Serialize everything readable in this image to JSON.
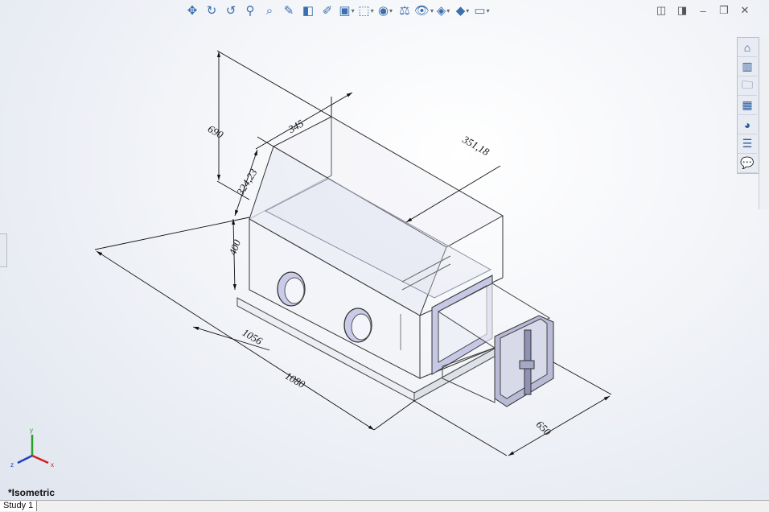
{
  "toolbar": {
    "items": [
      {
        "icon": "pan-icon",
        "glyph": "✥"
      },
      {
        "icon": "rotate-icon",
        "glyph": "↻"
      },
      {
        "icon": "redo-view-icon",
        "glyph": "↺"
      },
      {
        "icon": "zoom-to-fit-icon",
        "glyph": "⚲"
      },
      {
        "icon": "zoom-area-icon",
        "glyph": "⌕"
      },
      {
        "icon": "previous-view-icon",
        "glyph": "✎"
      },
      {
        "icon": "section-view-icon",
        "glyph": "◧"
      },
      {
        "icon": "dynamic-annotation-icon",
        "glyph": "✐"
      },
      {
        "icon": "view-orientation-icon",
        "glyph": "▣",
        "dropdown": true
      },
      {
        "icon": "display-style-icon",
        "glyph": "⬚",
        "dropdown": true
      },
      {
        "icon": "hide-show-items-icon",
        "glyph": "◉",
        "dropdown": true
      },
      {
        "icon": "edit-appearance-icon",
        "glyph": "⚖"
      },
      {
        "icon": "apply-scene-icon",
        "glyph": "👁",
        "dropdown": true
      },
      {
        "icon": "view-settings-icon",
        "glyph": "◈",
        "dropdown": true
      },
      {
        "icon": "render-tools-icon",
        "glyph": "◆",
        "dropdown": true
      },
      {
        "icon": "monitor-icon",
        "glyph": "▭",
        "dropdown": true
      }
    ]
  },
  "window_controls": [
    {
      "icon": "tile-left-icon",
      "glyph": "◫"
    },
    {
      "icon": "tile-right-icon",
      "glyph": "◨"
    },
    {
      "icon": "minimize-icon",
      "glyph": "–"
    },
    {
      "icon": "restore-icon",
      "glyph": "❐"
    },
    {
      "icon": "close-icon",
      "glyph": "✕"
    }
  ],
  "task_pane": [
    {
      "icon": "home-icon",
      "glyph": "⌂"
    },
    {
      "icon": "parts-library-icon",
      "glyph": "▥"
    },
    {
      "icon": "file-explorer-icon",
      "glyph": "🗀"
    },
    {
      "icon": "view-palette-icon",
      "glyph": "▦"
    },
    {
      "icon": "appearances-icon",
      "glyph": "◕"
    },
    {
      "icon": "custom-properties-icon",
      "glyph": "☰"
    },
    {
      "icon": "forum-icon",
      "glyph": "💬"
    }
  ],
  "dimensions": {
    "height": "690",
    "top_depth": "345",
    "slope": "324,23",
    "lid": "351,18",
    "base_height": "400",
    "inner_length": "1056",
    "length": "1080",
    "width": "650"
  },
  "axes": {
    "x": "x",
    "y": "y",
    "z": "z"
  },
  "view_label": "*Isometric",
  "tabs": [
    "Study 1"
  ]
}
